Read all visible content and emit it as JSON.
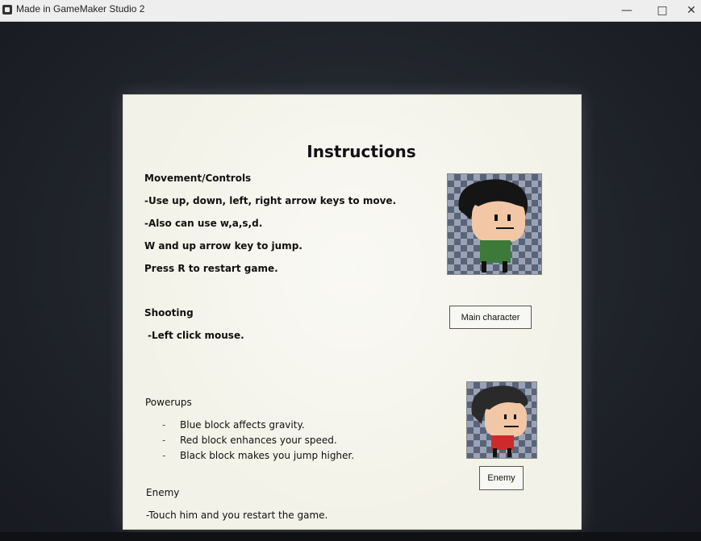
{
  "window": {
    "title": "Made in GameMaker Studio 2",
    "minimize_glyph": "—",
    "maximize_glyph": "□",
    "close_glyph": "✕"
  },
  "instructions": {
    "title": "Instructions",
    "movement": {
      "heading": "Movement/Controls",
      "lines": [
        "-Use up, down, left, right arrow keys to move.",
        "-Also can use w,a,s,d.",
        "W and up arrow key to jump.",
        "Press R to restart game."
      ]
    },
    "shooting": {
      "heading": "Shooting",
      "lines": [
        "-Left click mouse."
      ]
    },
    "powerups": {
      "heading": "Powerups",
      "items": [
        "Blue block affects gravity.",
        "Red block enhances your speed.",
        "Black block makes you jump higher."
      ]
    },
    "enemy": {
      "heading": "Enemy",
      "lines": [
        "-Touch him and you restart the game."
      ]
    }
  },
  "characters": {
    "main": {
      "caption": "Main character",
      "shirt_color": "#3d7a3a"
    },
    "enemy": {
      "caption": "Enemy",
      "shirt_color": "#cc2b2b"
    }
  },
  "icons": {
    "app": "gamemaker-icon",
    "bullet": "-"
  }
}
